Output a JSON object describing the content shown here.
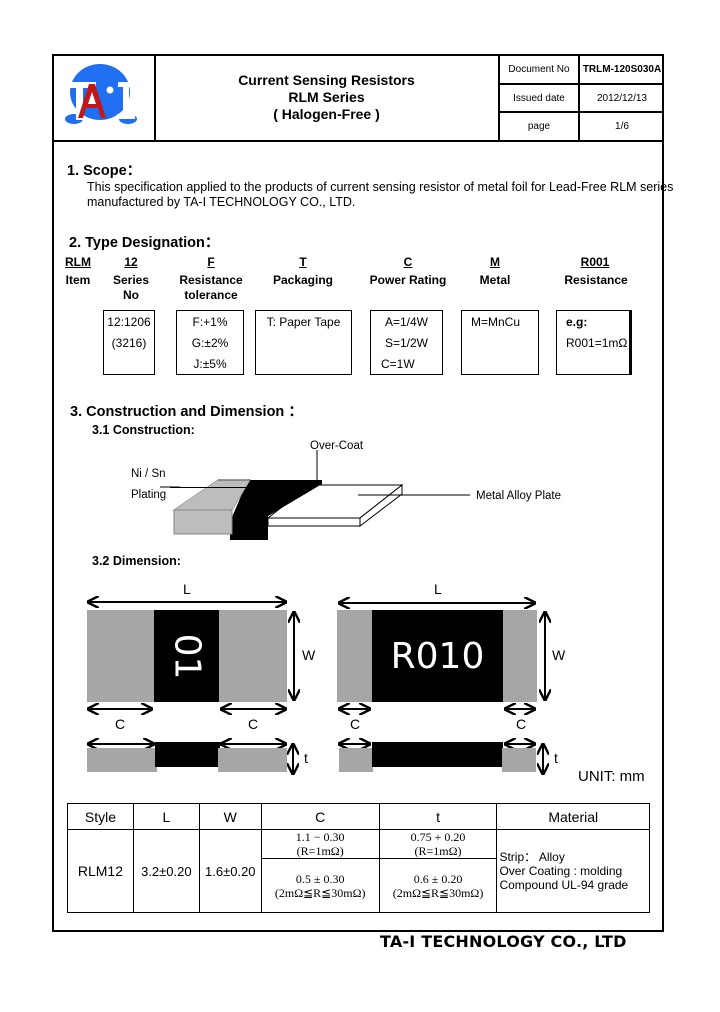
{
  "header": {
    "logo": {
      "name": "ta-i-logo",
      "accent_blue": "#1f6ff0",
      "accent_red": "#c01818"
    },
    "title_lines": [
      "Current Sensing Resistors",
      "RLM Series",
      "( Halogen-Free )"
    ],
    "meta": [
      {
        "label": "Document No",
        "value": "TRLM-120S030A"
      },
      {
        "label": "Issued date",
        "value": "2012/12/13"
      },
      {
        "label": "page",
        "value": "1/6"
      }
    ]
  },
  "scope": {
    "heading": "1. Scope：",
    "text_lines": [
      "This specification applied to the products of current sensing resistor of metal foil for Lead-Free RLM series",
      "manufactured by TA-I TECHNOLOGY CO., LTD."
    ]
  },
  "type_designation": {
    "heading": "2. Type Designation：",
    "columns": [
      {
        "code": "RLM",
        "name_lines": [
          "Item"
        ],
        "options": []
      },
      {
        "code": "12",
        "name_lines": [
          "Series",
          "No"
        ],
        "options": [
          "12:1206",
          "(3216)"
        ]
      },
      {
        "code": "F",
        "name_lines": [
          "Resistance",
          "tolerance"
        ],
        "options": [
          "F:+1%",
          "G:±2%",
          "J:±5%"
        ]
      },
      {
        "code": "T",
        "name_lines": [
          "Packaging"
        ],
        "options": [
          "T: Paper Tape"
        ]
      },
      {
        "code": "C",
        "name_lines": [
          "Power Rating"
        ],
        "options": [
          "A=1/4W",
          "S=1/2W",
          "C=1W"
        ]
      },
      {
        "code": "M",
        "name_lines": [
          "Metal"
        ],
        "options": [
          "M=MnCu"
        ]
      },
      {
        "code": "R001",
        "name_lines": [
          "Resistance"
        ],
        "options": [
          "e.g:",
          "R001=1mΩ"
        ]
      }
    ]
  },
  "construction": {
    "heading": "3. Construction and Dimension ：",
    "sub_heading": "3.1 Construction:",
    "labels": {
      "overcoat": "Over-Coat",
      "plating_line1": "Ni / Sn",
      "plating_line2": "Plating",
      "metal": "Metal Alloy Plate"
    }
  },
  "dimension": {
    "sub_heading": "3.2 Dimension:",
    "left_marking": "01",
    "right_marking": "R010",
    "labels": {
      "L": "L",
      "W": "W",
      "C": "C",
      "t": "t"
    },
    "unit": "UNIT: mm"
  },
  "spec_table": {
    "headers": [
      "Style",
      "L",
      "W",
      "C",
      "t",
      "Material"
    ],
    "row": {
      "style": "RLM12",
      "L": "3.2±0.20",
      "W": "1.6±0.20",
      "C": [
        {
          "value": "1.1 − 0.30",
          "condition": "(R=1mΩ)"
        },
        {
          "value": "0.5 ± 0.30",
          "condition": "(2mΩ≦R≦30mΩ)"
        }
      ],
      "t": [
        {
          "value": "0.75 + 0.20",
          "condition": "(R=1mΩ)"
        },
        {
          "value": "0.6 ± 0.20",
          "condition": "(2mΩ≦R≦30mΩ)"
        }
      ],
      "material_lines": [
        "Strip：  Alloy",
        "Over Coating : molding",
        "Compound UL-94 grade"
      ]
    }
  },
  "footer": {
    "company": "TA-I TECHNOLOGY CO., LTD"
  }
}
